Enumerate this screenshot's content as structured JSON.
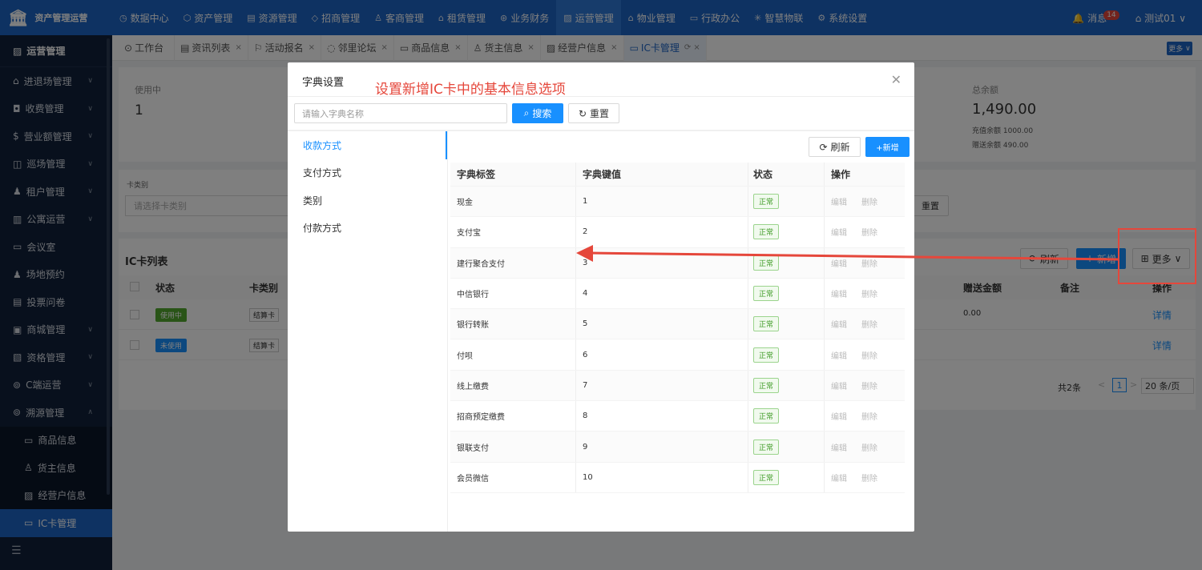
{
  "topbar": {
    "logo_text": "资产管理运营",
    "nav": [
      {
        "icon": "clock-icon",
        "glyph": "◷",
        "label": "数据中心"
      },
      {
        "icon": "cube-icon",
        "glyph": "⬡",
        "label": "资产管理"
      },
      {
        "icon": "doc-icon",
        "glyph": "▤",
        "label": "资源管理"
      },
      {
        "icon": "diamond-icon",
        "glyph": "◇",
        "label": "招商管理"
      },
      {
        "icon": "user-icon",
        "glyph": "♙",
        "label": "客商管理"
      },
      {
        "icon": "building-icon",
        "glyph": "⌂",
        "label": "租赁管理"
      },
      {
        "icon": "money-icon",
        "glyph": "⊛",
        "label": "业务财务"
      },
      {
        "icon": "chart-icon",
        "glyph": "▨",
        "label": "运营管理"
      },
      {
        "icon": "house-icon",
        "glyph": "⌂",
        "label": "物业管理"
      },
      {
        "icon": "monitor-icon",
        "glyph": "▭",
        "label": "行政办公"
      },
      {
        "icon": "iot-icon",
        "glyph": "✳",
        "label": "智慧物联"
      },
      {
        "icon": "gear-icon",
        "glyph": "⚙",
        "label": "系统设置"
      }
    ],
    "message_label": "消息",
    "message_count": "14",
    "user_label": "测试01"
  },
  "sidebar": {
    "head": "运营管理",
    "items": [
      {
        "label": "进退场管理",
        "glyph": "⌂",
        "chev": "∨"
      },
      {
        "label": "收费管理",
        "glyph": "◘",
        "chev": "∨"
      },
      {
        "label": "营业额管理",
        "glyph": "$",
        "chev": "∨"
      },
      {
        "label": "巡场管理",
        "glyph": "◫",
        "chev": "∨"
      },
      {
        "label": "租户管理",
        "glyph": "♟",
        "chev": "∨"
      },
      {
        "label": "公寓运营",
        "glyph": "▥",
        "chev": "∨"
      },
      {
        "label": "会议室",
        "glyph": "▭",
        "chev": ""
      },
      {
        "label": "场地预约",
        "glyph": "♟",
        "chev": ""
      },
      {
        "label": "投票问卷",
        "glyph": "▤",
        "chev": ""
      },
      {
        "label": "商城管理",
        "glyph": "▣",
        "chev": "∨"
      },
      {
        "label": "资格管理",
        "glyph": "▧",
        "chev": "∨"
      },
      {
        "label": "C端运营",
        "glyph": "⊚",
        "chev": "∨"
      },
      {
        "label": "溯源管理",
        "glyph": "⊚",
        "chev": "∧"
      }
    ],
    "sub_items": [
      {
        "label": "商品信息",
        "glyph": "▭"
      },
      {
        "label": "货主信息",
        "glyph": "♙"
      },
      {
        "label": "经营户信息",
        "glyph": "▨"
      },
      {
        "label": "IC卡管理",
        "glyph": "▭"
      }
    ],
    "collapse_glyph": "☰"
  },
  "tabs": [
    {
      "label": "工作台",
      "glyph": "⊙",
      "close": ""
    },
    {
      "label": "资讯列表",
      "glyph": "▤",
      "close": "×"
    },
    {
      "label": "活动报名",
      "glyph": "⚐",
      "close": "×"
    },
    {
      "label": "邻里论坛",
      "glyph": "◌",
      "close": "×"
    },
    {
      "label": "商品信息",
      "glyph": "▭",
      "close": "×"
    },
    {
      "label": "货主信息",
      "glyph": "♙",
      "close": "×"
    },
    {
      "label": "经营户信息",
      "glyph": "▨",
      "close": "×"
    },
    {
      "label": "IC卡管理",
      "glyph": "▭",
      "close": "⟳ ×"
    }
  ],
  "more_top": "更多",
  "background": {
    "stat_in_use_label": "使用中",
    "stat_in_use_value": "1",
    "stat_balance_label": "总余额",
    "stat_balance_value": "1,490.00",
    "stat_recharge": "充值余额 1000.00",
    "stat_gift": "赠送余额 490.00",
    "filter_label": "卡类别",
    "filter_placeholder": "请选择卡类别",
    "filter_reset": "重置",
    "list_title": "IC卡列表",
    "refresh": "刷新",
    "add": "新增",
    "more": "更多",
    "col_status": "状态",
    "col_type": "卡类别",
    "col_gift": "赠送金额",
    "col_remark": "备注",
    "col_ops": "操作",
    "rows": [
      {
        "status": "使用中",
        "status_color": "#52a82f",
        "type": "结算卡",
        "gift": "0.00",
        "op": "详情"
      },
      {
        "status": "未使用",
        "status_color": "#1890ff",
        "type": "结算卡",
        "gift": "",
        "op": "详情"
      }
    ],
    "total": "共2条",
    "page": "1",
    "page_size": "20 条/页"
  },
  "modal": {
    "title": "字典设置",
    "search_placeholder": "请输入字典名称",
    "search_btn": "搜索",
    "reset_btn": "重置",
    "categories": [
      "收款方式",
      "支付方式",
      "类别",
      "付款方式"
    ],
    "refresh_btn": "刷新",
    "add_btn": "+新增",
    "columns": [
      "字典标签",
      "字典键值",
      "状态",
      "操作"
    ],
    "rows": [
      {
        "label": "现金",
        "key": "1",
        "status": "正常"
      },
      {
        "label": "支付宝",
        "key": "2",
        "status": "正常"
      },
      {
        "label": "建行聚合支付",
        "key": "3",
        "status": "正常"
      },
      {
        "label": "中信银行",
        "key": "4",
        "status": "正常"
      },
      {
        "label": "银行转账",
        "key": "5",
        "status": "正常"
      },
      {
        "label": "付呗",
        "key": "6",
        "status": "正常"
      },
      {
        "label": "线上缴费",
        "key": "7",
        "status": "正常"
      },
      {
        "label": "招商预定缴费",
        "key": "8",
        "status": "正常"
      },
      {
        "label": "银联支付",
        "key": "9",
        "status": "正常"
      },
      {
        "label": "会员微信",
        "key": "10",
        "status": "正常"
      }
    ],
    "edit": "编辑",
    "delete": "删除"
  },
  "annotation": {
    "note": "设置新增IC卡中的基本信息选项",
    "color": "#e5473b"
  }
}
